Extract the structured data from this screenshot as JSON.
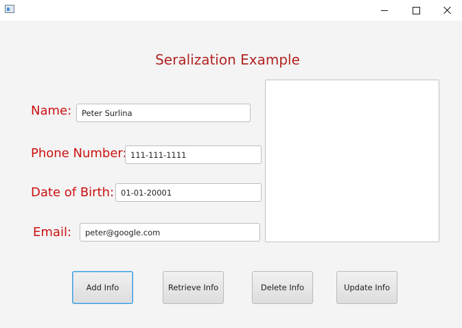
{
  "window": {
    "icon": "app-window-icon",
    "controls": {
      "minimize": "minimize-icon",
      "maximize": "maximize-icon",
      "close": "close-icon"
    }
  },
  "form": {
    "title": "Seralization Example",
    "name": {
      "label": "Name:",
      "value": "Peter Surlina"
    },
    "phone": {
      "label": "Phone Number:",
      "value": "111-111-1111"
    },
    "dob": {
      "label": "Date of Birth:",
      "value": "01-01-20001"
    },
    "email": {
      "label": "Email:",
      "value": "peter@google.com"
    },
    "output": ""
  },
  "buttons": {
    "add": "Add Info",
    "retrieve": "Retrieve Info",
    "delete": "Delete Info",
    "update": "Update Info"
  },
  "colors": {
    "label": "#cc1010",
    "title": "#b22222",
    "focus": "#3a9bd9"
  }
}
